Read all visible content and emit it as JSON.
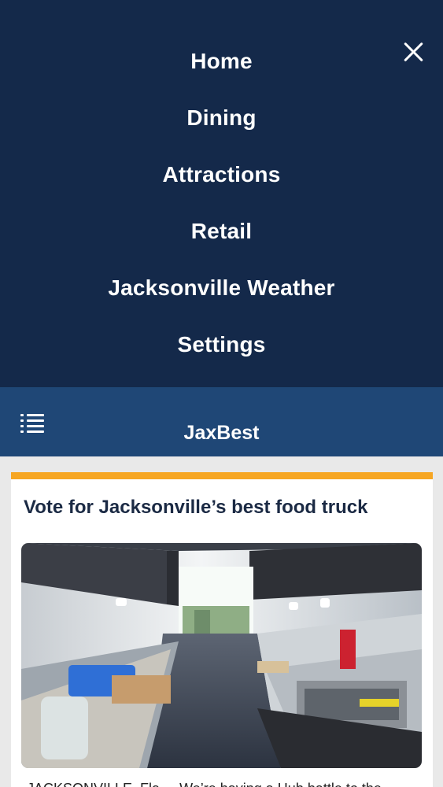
{
  "menu": {
    "items": [
      {
        "label": "Home"
      },
      {
        "label": "Dining"
      },
      {
        "label": "Attractions"
      },
      {
        "label": "Retail"
      },
      {
        "label": "Jacksonville Weather"
      },
      {
        "label": "Settings"
      }
    ],
    "close_icon": "close-icon"
  },
  "header": {
    "title": "JaxBest",
    "menu_icon": "list-menu-icon"
  },
  "article": {
    "title": "Vote for Jacksonville’s best food truck",
    "snippet": "JACKSONVILLE, Fla. – We’re having a Hub battle to the",
    "accent_color": "#f6a623"
  },
  "colors": {
    "menu_bg": "#14294a",
    "header_bg": "#1f4776",
    "page_bg": "#e9e9e9"
  }
}
